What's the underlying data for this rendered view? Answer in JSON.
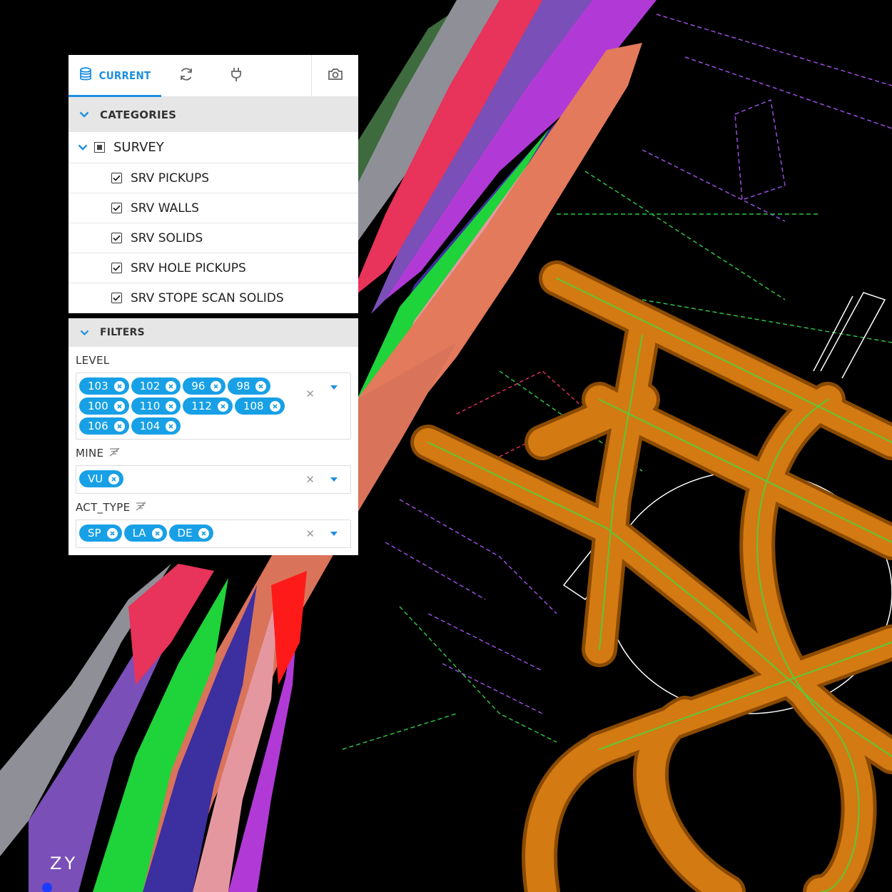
{
  "tabs": {
    "current_label": "CURRENT",
    "icons": [
      "database-icon",
      "refresh-icon",
      "plug-icon",
      "camera-icon"
    ]
  },
  "categories": {
    "title": "CATEGORIES",
    "group": "SURVEY",
    "items": [
      "SRV PICKUPS",
      "SRV WALLS",
      "SRV SOLIDS",
      "SRV HOLE PICKUPS",
      "SRV STOPE SCAN SOLIDS"
    ]
  },
  "filters": {
    "title": "FILTERS",
    "level": {
      "label": "LEVEL",
      "values": [
        "103",
        "102",
        "96",
        "98",
        "100",
        "110",
        "112",
        "108",
        "106",
        "104"
      ]
    },
    "mine": {
      "label": "MINE",
      "values": [
        "VU"
      ]
    },
    "act_type": {
      "label": "ACT_TYPE",
      "values": [
        "SP",
        "LA",
        "DE"
      ]
    }
  },
  "viewport": {
    "axis_label": "ZY"
  },
  "colors": {
    "accent": "#1f8fe0",
    "chip": "#18a0e6"
  }
}
